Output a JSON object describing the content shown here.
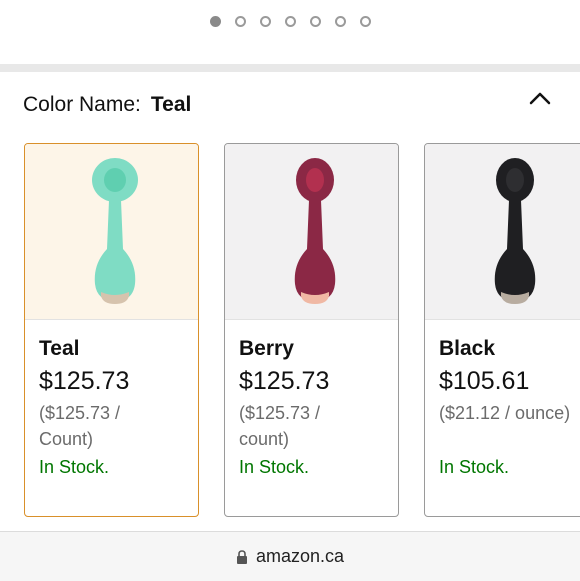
{
  "carousel": {
    "dot_count": 7,
    "active_index": 0
  },
  "color_selector": {
    "label": "Color Name:",
    "selected": "Teal"
  },
  "products": [
    {
      "name": "Teal",
      "price": "$125.73",
      "unit_line1": "($125.73 /",
      "unit_line2": "Count)",
      "stock": "In Stock.",
      "color": "#7fdcc4",
      "accent": "#5fcfb0"
    },
    {
      "name": "Berry",
      "price": "$125.73",
      "unit_line1": "($125.73 /",
      "unit_line2": "count)",
      "stock": "In Stock.",
      "color": "#8b2845",
      "accent": "#b2304f"
    },
    {
      "name": "Black",
      "price": "$105.61",
      "unit_line1": "($21.12 / ounce)",
      "unit_line2": "",
      "stock": "In Stock.",
      "color": "#1f1f22",
      "accent": "#2e2e31"
    }
  ],
  "address_bar": {
    "url": "amazon.ca"
  }
}
